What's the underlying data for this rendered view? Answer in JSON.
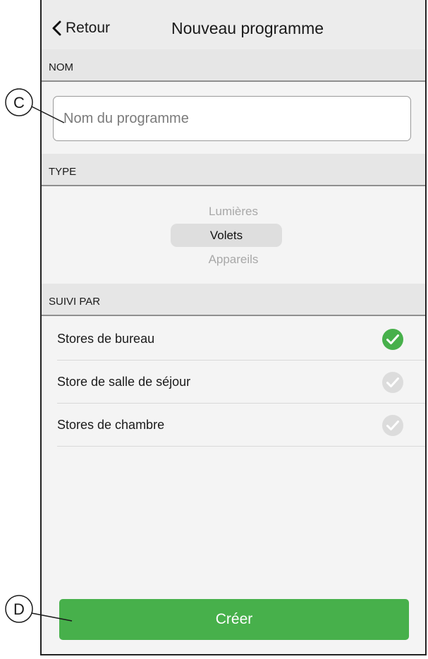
{
  "nav": {
    "back_label": "Retour",
    "title": "Nouveau programme"
  },
  "sections": {
    "name": "NOM",
    "type": "TYPE",
    "followed": "SUIVI PAR"
  },
  "name_input": {
    "value": "",
    "placeholder": "Nom du programme"
  },
  "type_picker": {
    "options": [
      "Lumières",
      "Volets",
      "Appareils"
    ],
    "selected": "Volets"
  },
  "followed_items": [
    {
      "label": "Stores de bureau",
      "checked": true
    },
    {
      "label": "Store de salle de séjour",
      "checked": false
    },
    {
      "label": "Stores de chambre",
      "checked": false
    }
  ],
  "create_button": "Créer",
  "callouts": {
    "c": "C",
    "d": "D"
  },
  "colors": {
    "accent_green": "#47b04b",
    "unchecked_gray": "#dcdcdc"
  },
  "icons": {
    "back": "chevron-left-icon",
    "check": "checkmark-circle-icon"
  }
}
